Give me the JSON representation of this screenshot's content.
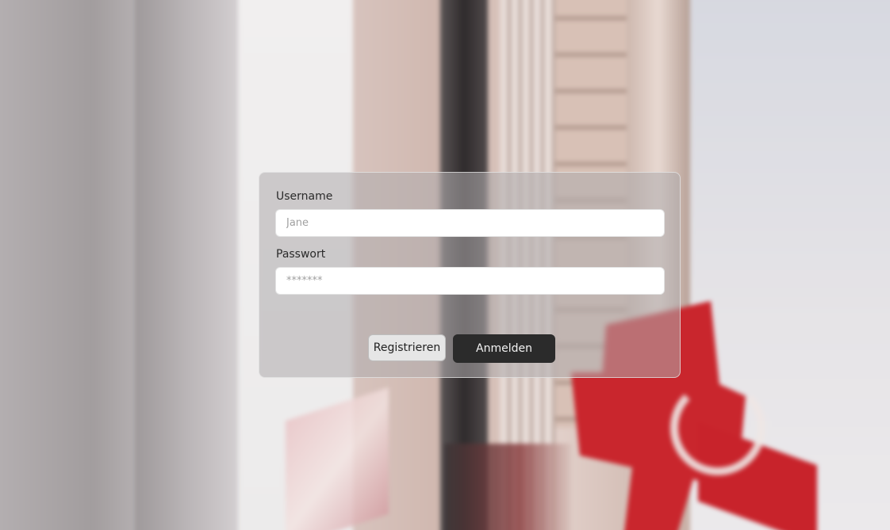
{
  "login_form": {
    "username_label": "Username",
    "username_placeholder": "Jane",
    "password_label": "Passwort",
    "password_placeholder": "*******",
    "register_label": "Registrieren",
    "login_label": "Anmelden"
  }
}
